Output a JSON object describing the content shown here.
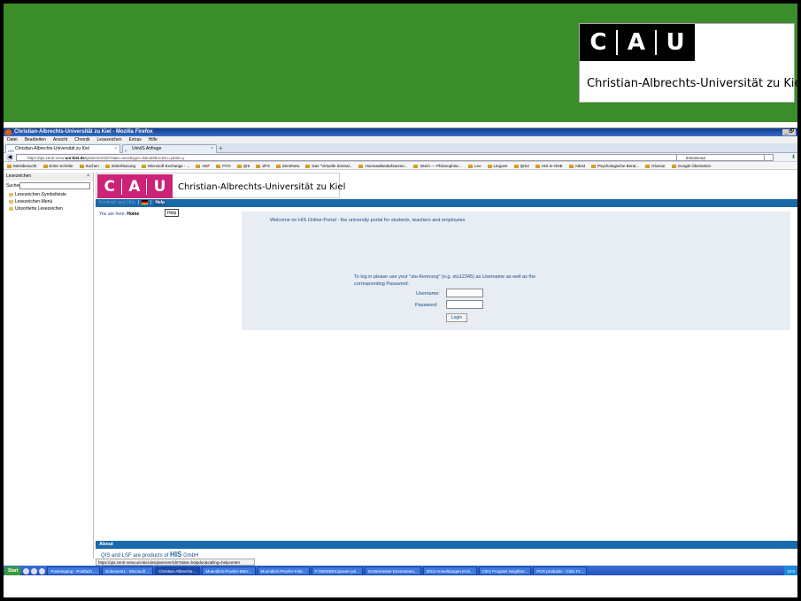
{
  "slide": {
    "logo_letters": [
      "C",
      "A",
      "U"
    ],
    "logo_university": "Christian-Albrechts-Universität zu Kiel",
    "header_color": "#3b8c2a"
  },
  "browser": {
    "window_title": "Christian-Albrechts-Universität zu Kiel - Mozilla Firefox",
    "window_controls": "_ 🗗",
    "menu": [
      "Datei",
      "Bearbeiten",
      "Ansicht",
      "Chronik",
      "Lesezeichen",
      "Extras",
      "Hilfe"
    ],
    "tabs": [
      {
        "label": "Christian-Albrechts-Universität zu Kiel",
        "icon": "HIS"
      },
      {
        "label": "UnivIS Anfrage",
        "icon": "≡"
      }
    ],
    "url_prefix": "https://qis.zentr-verw.",
    "url_domain": "uni-kiel.de",
    "url_suffix": "/qisserver/rds?state=user&type=0&noDBAction=y&init=y",
    "search_text": "immoscout",
    "bookmarks": [
      "Meistbesucht",
      "Erste Schritte",
      "Suchen",
      "Zeiterfassung",
      "Microsoft Exchange - ...",
      "AEF",
      "PYO",
      "QIS",
      "ZFS",
      "ZentrNew",
      "Das \"Virtuelle Zentral...",
      "Hoersaalbedarfsanme...",
      "Intern — Philosophisc...",
      "Leo",
      "Linguee",
      "QIS2",
      "HIS-in-ONE",
      "Attest",
      "Psychologische Berat...",
      "Glossar",
      "Google Übersetzer"
    ],
    "status_url": "https://qis.zentr-verw.uni-kiel.de/qisserver/rds?state=helpdoc&calling=helpcenter"
  },
  "sidebar": {
    "title": "Lesezeichen",
    "close": "×",
    "search_label": "Suchen:",
    "items": [
      "Lesezeichen-Symbolleiste",
      "Lesezeichen-Menü",
      "Unsortierte Lesezeichen"
    ]
  },
  "portal": {
    "logo_letters": [
      "C",
      "A",
      "U"
    ],
    "title": "Christian-Albrechts-Universität zu Kiel",
    "bar_text": "Kontrast: aus | Ein",
    "help_top": "Help",
    "you_are_here": "You are here:",
    "home": "Home",
    "help_button": "Help",
    "welcome": "Welcome on HIS Online-Portal - the university portal for students, teachers and employees",
    "instructions": "To log in please use your \"stu-Kennung\" (e.g. stu12345) as Username as well as the corresponding Password.",
    "username_label": "Username:",
    "password_label": "Password:",
    "login_button": "Login",
    "about": "About",
    "footer_pre": "QIS and LSF are products of",
    "footer_his": "HIS",
    "footer_post": "GmbH"
  },
  "taskbar": {
    "start": "Start",
    "tasks": [
      "Posteingang - Postfach ...",
      "Dokument1 - Microsoft ...",
      "Christian-Albrechts-...",
      "Muendlich-Pruefer-März...",
      "Muendlich-Pruefer-Febr...",
      "P:\\SENIBEIL\\power-pol...",
      "Erstsemester Environmen...",
      "2013-Anmeldungen Envi...",
      "Citrix Program Neighbor...",
      "POS produktiv - Citrix Pr..."
    ],
    "clock": "10:0"
  }
}
